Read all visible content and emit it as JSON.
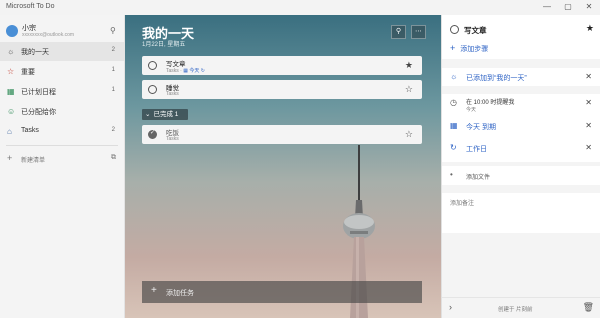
{
  "window": {
    "title": "Microsoft To Do",
    "min": "—",
    "max": "▢",
    "close": "✕"
  },
  "profile": {
    "name": "小宗",
    "email": "xxxxxxxx@outlook.com",
    "search_icon": "search-icon"
  },
  "sidebar": {
    "items": [
      {
        "label": "我的一天",
        "count": "2",
        "icon": "sun-icon",
        "color": "#555555"
      },
      {
        "label": "重要",
        "count": "1",
        "icon": "star-icon",
        "color": "#c0392b"
      },
      {
        "label": "已计划日程",
        "count": "1",
        "icon": "calendar-icon",
        "color": "#2e8b57"
      },
      {
        "label": "已分配给你",
        "count": "",
        "icon": "person-icon",
        "color": "#2e8b57"
      },
      {
        "label": "Tasks",
        "count": "2",
        "icon": "home-icon",
        "color": "#4a6fa5"
      }
    ],
    "new_list": "新建清单"
  },
  "main": {
    "title": "我的一天",
    "date": "1月22日, 星期五",
    "tasks": [
      {
        "name": "写文章",
        "list": "Tasks",
        "due": "今天",
        "starred": true
      },
      {
        "name": "睡觉",
        "list": "Tasks",
        "due": "",
        "starred": false
      }
    ],
    "completed_label": "已完成",
    "completed_count": "1",
    "completed_tasks": [
      {
        "name": "吃饭",
        "list": "Tasks",
        "starred": false
      }
    ],
    "add_task": "添加任务"
  },
  "detail": {
    "title": "写文章",
    "add_step": "添加步骤",
    "added_my_day": "已添加到“我的一天”",
    "reminder": "在 10:00 时提醒我",
    "reminder_sub": "今天",
    "due": "今天 到期",
    "repeat": "工作日",
    "add_file": "添加文件",
    "add_note": "添加备注",
    "created": "创建于 片刻前"
  },
  "colors": {
    "accent": "#2e63c5",
    "sidebar_bg": "#f4f4f4",
    "avatar": "#4a8fd6"
  }
}
